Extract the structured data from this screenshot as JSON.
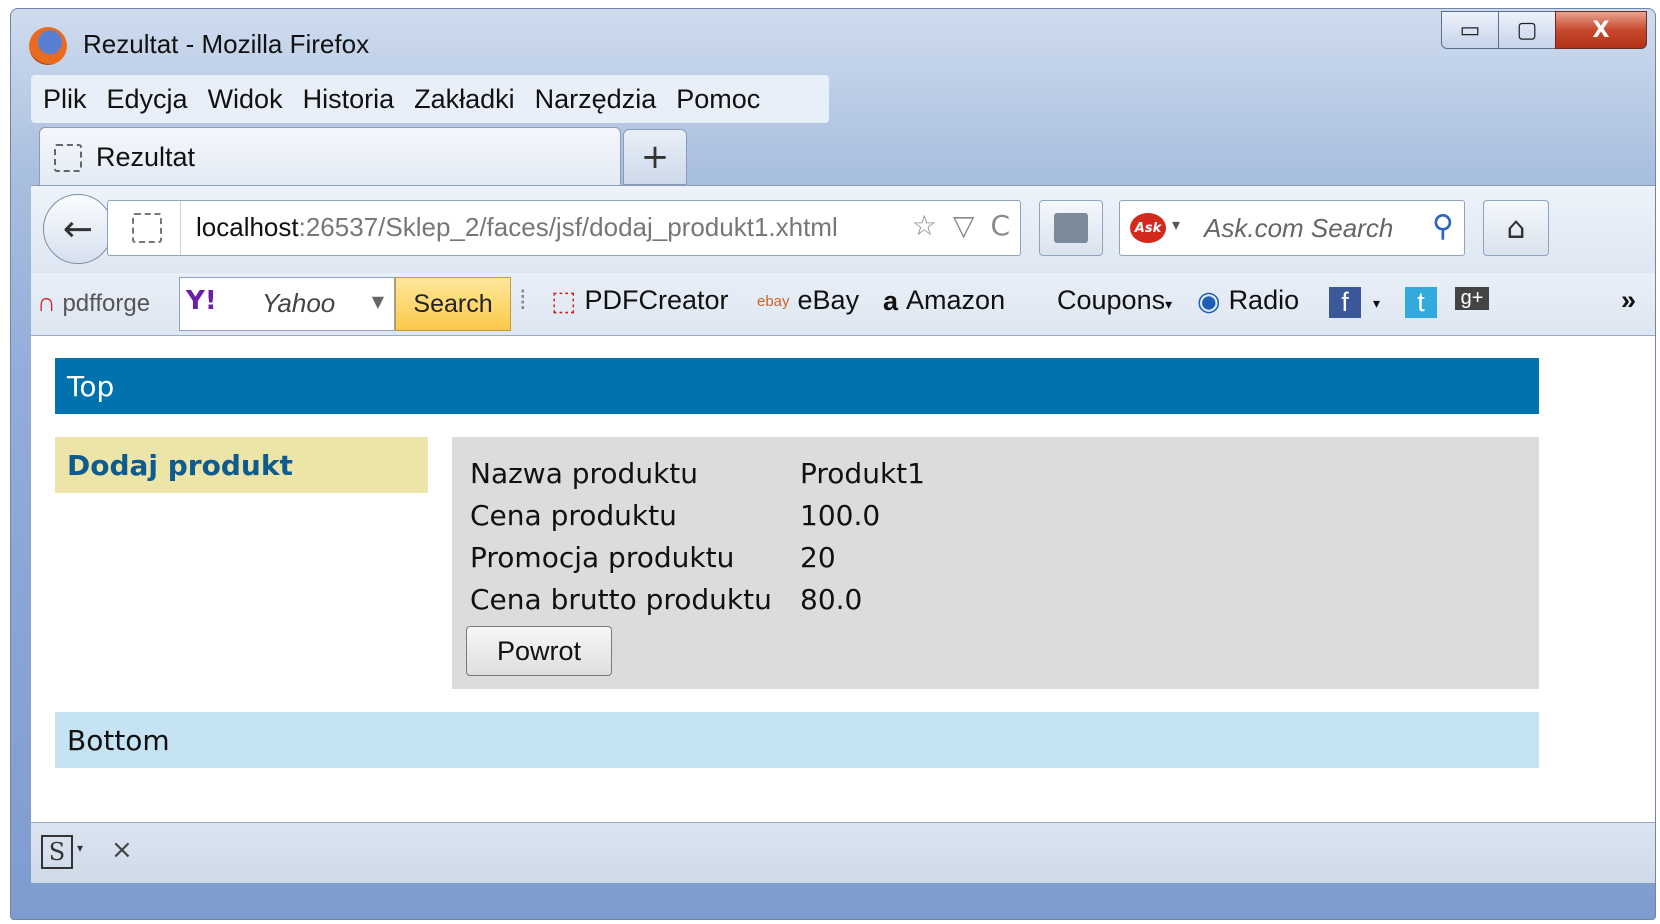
{
  "window": {
    "title": "Rezultat - Mozilla Firefox",
    "controls": {
      "minimize": "▭",
      "maximize": "▢",
      "close": "X"
    }
  },
  "menubar": {
    "items": [
      "Plik",
      "Edycja",
      "Widok",
      "Historia",
      "Zakładki",
      "Narzędzia",
      "Pomoc"
    ]
  },
  "tabs": {
    "active_label": "Rezultat",
    "new_tab": "+"
  },
  "navbar": {
    "back": "←",
    "url_host": "localhost",
    "url_rest": ":26537/Sklep_2/faces/jsf/dodaj_produkt1.xhtml",
    "star": "☆",
    "dropdown": "▽",
    "reload": "C",
    "search_placeholder": "Ask.com Search",
    "ask_logo": "Ask",
    "search_icon": "⚲",
    "home": "⌂"
  },
  "bookmarks": {
    "pdfforge": "pdfforge",
    "yahoo_logo": "Y!",
    "yahoo_text": "Yahoo",
    "search_button": "Search",
    "items": [
      {
        "icon": "pdf-icon",
        "label": "PDFCreator"
      },
      {
        "icon": "ebay-icon",
        "label": "eBay"
      },
      {
        "icon": "amazon-icon",
        "label": "Amazon"
      },
      {
        "icon": "",
        "label": "Coupons"
      },
      {
        "icon": "radio-icon",
        "label": "Radio"
      }
    ],
    "overflow": "»"
  },
  "page": {
    "top": "Top",
    "left_title": "Dodaj produkt",
    "fields": [
      {
        "label": "Nazwa produktu",
        "value": "Produkt1"
      },
      {
        "label": "Cena produktu",
        "value": "100.0"
      },
      {
        "label": "Promocja produktu",
        "value": "20"
      },
      {
        "label": "Cena brutto produktu",
        "value": "80.0"
      }
    ],
    "back_button": "Powrot",
    "bottom": "Bottom"
  },
  "statusbar": {
    "s_icon": "S",
    "close": "×"
  }
}
